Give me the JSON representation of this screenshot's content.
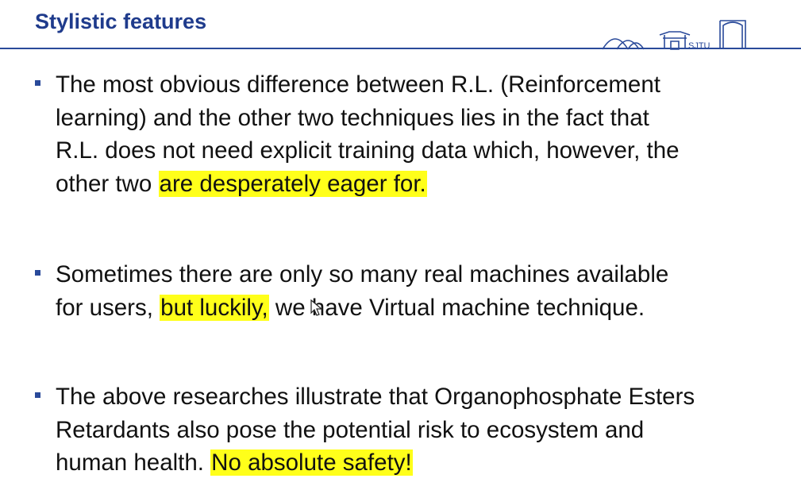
{
  "slide": {
    "title": "Stylistic features",
    "logo_text": "SJTU",
    "colors": {
      "title": "#1f3b8c",
      "rule": "#2a4a9a",
      "highlight": "#ffff1a",
      "text": "#111111"
    },
    "bullets": [
      {
        "lines": [
          "The most obvious difference between R.L. (Reinforcement",
          "learning) and the other two techniques lies in the fact that",
          "R.L. does not need explicit training data which, however, the"
        ],
        "last_line_plain": "other two ",
        "last_line_highlight": "are desperately eager for."
      },
      {
        "line1": "Sometimes there are only so many real machines available",
        "line2_pre": "for users, ",
        "line2_highlight": "but luckily,",
        "line2_post": " we have Virtual machine technique."
      },
      {
        "line1": "The above researches illustrate that Organophosphate Esters",
        "line2": "Retardants also pose the potential risk to ecosystem and",
        "line3_pre": "human health. ",
        "line3_highlight": "No absolute safety!"
      }
    ]
  },
  "icons": {
    "logo": "sjtu-gate-logo-icon",
    "cursor": "mouse-cursor-icon",
    "bullet": "square-bullet-icon"
  }
}
